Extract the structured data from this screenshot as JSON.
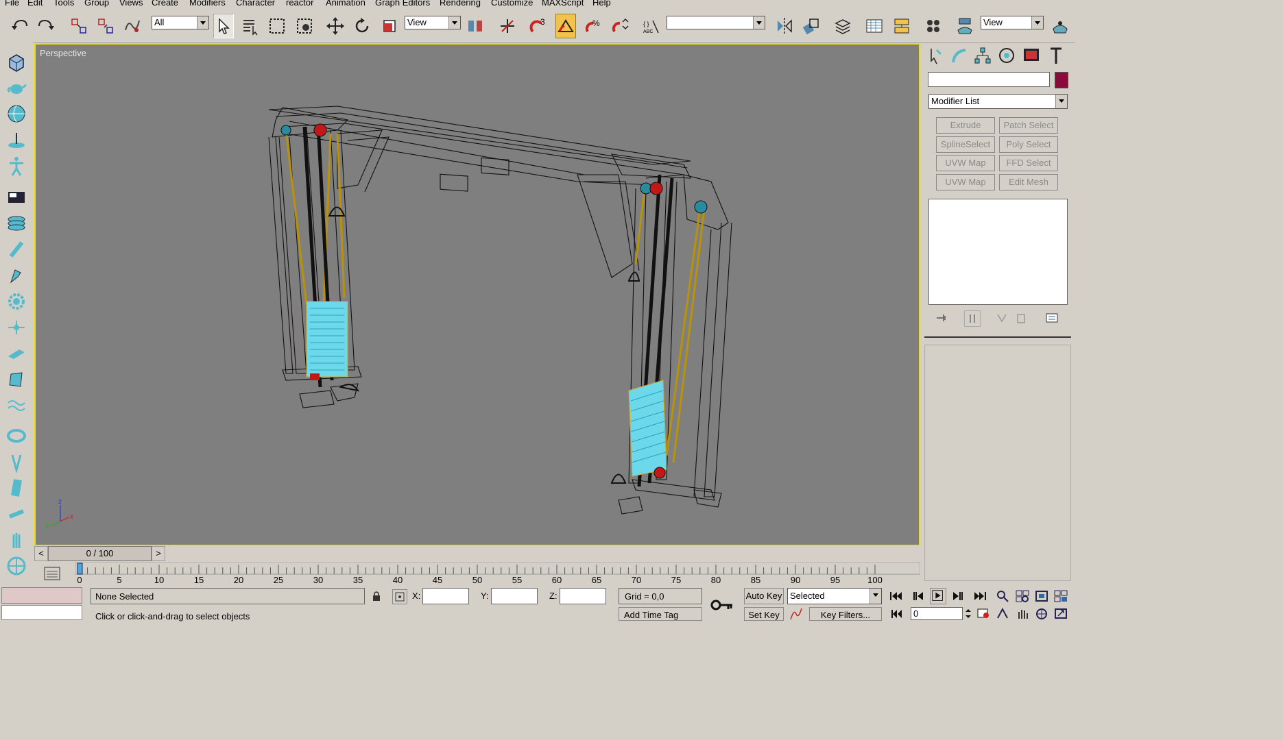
{
  "menu": [
    "File",
    "Edit",
    "Tools",
    "Group",
    "Views",
    "Create",
    "Modifiers",
    "Character",
    "reactor",
    "Animation",
    "Graph Editors",
    "Rendering",
    "Customize",
    "MAXScript",
    "Help"
  ],
  "toolbar": {
    "selection_filter": "All",
    "ref_coord": "View",
    "named_selection": "",
    "render_view": "View",
    "snap_label": "3"
  },
  "viewport": {
    "label": "Perspective",
    "axes": {
      "x": "x",
      "y": "y",
      "z": "z"
    }
  },
  "cmd_panel": {
    "name_value": "",
    "object_color": "#8b0a3a",
    "modifier_list": "Modifier List",
    "buttons": [
      "Extrude",
      "Patch Select",
      "SplineSelect",
      "Poly Select",
      "UVW Map",
      "FFD Select",
      "UVW Map",
      "Edit Mesh"
    ]
  },
  "timeslider": {
    "frame": "0 / 100",
    "prev": "<",
    "next": ">"
  },
  "ticks": [
    "0",
    "5",
    "10",
    "15",
    "20",
    "25",
    "30",
    "35",
    "40",
    "45",
    "50",
    "55",
    "60",
    "65",
    "70",
    "75",
    "80",
    "85",
    "90",
    "95",
    "100"
  ],
  "status": {
    "selection": "None Selected",
    "prompt": "Click or click-and-drag to select objects",
    "x_label": "X:",
    "y_label": "Y:",
    "z_label": "Z:",
    "x_value": "",
    "y_value": "",
    "z_value": "",
    "grid": "Grid = 0,0",
    "add_time_tag": "Add Time Tag",
    "auto_key": "Auto Key",
    "set_key": "Set Key",
    "key_mode": "Selected",
    "key_filters": "Key Filters...",
    "current_frame": "0"
  }
}
